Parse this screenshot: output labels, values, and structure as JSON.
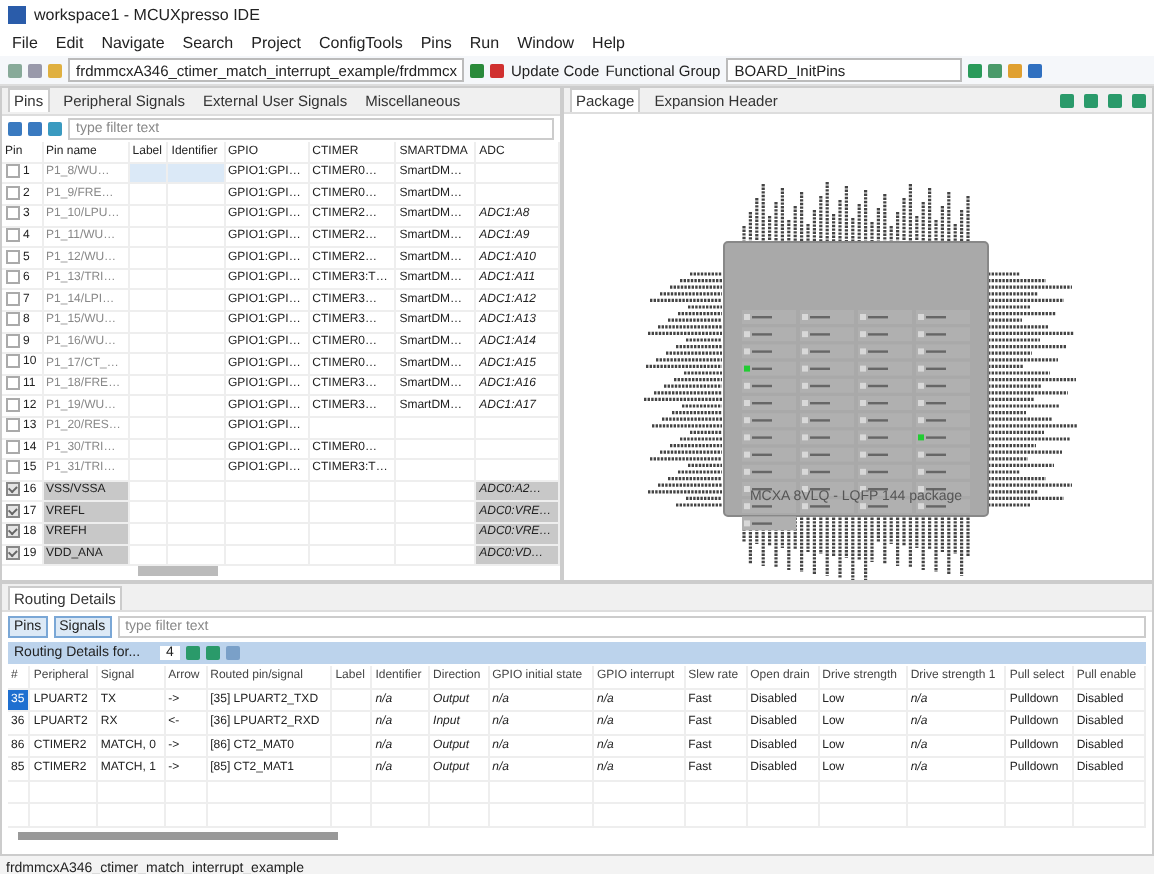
{
  "window": {
    "title": "workspace1 - MCUXpresso IDE"
  },
  "menu": [
    "File",
    "Edit",
    "Navigate",
    "Search",
    "Project",
    "ConfigTools",
    "Pins",
    "Run",
    "Window",
    "Help"
  ],
  "toolbar": {
    "project_path": "frdmmcxA346_ctimer_match_interrupt_example/frdmmcx",
    "update_code": "Update Code",
    "functional_group_label": "Functional Group",
    "functional_group": "BOARD_InitPins"
  },
  "pins_view": {
    "tabs": [
      {
        "label": "Pins",
        "selected": true
      },
      {
        "label": "Peripheral Signals",
        "selected": false
      },
      {
        "label": "External User Signals",
        "selected": false
      },
      {
        "label": "Miscellaneous",
        "selected": false
      }
    ],
    "filter": {
      "placeholder": "type filter text"
    },
    "columns": [
      "Pin",
      "Pin name",
      "Label",
      "Identifier",
      "GPIO",
      "CTIMER",
      "SMARTDMA",
      "ADC"
    ],
    "rows": [
      {
        "checked": false,
        "selected": true,
        "disabled": false,
        "cells": [
          "1",
          "P1_8/WU…",
          "",
          "",
          "GPIO1:GPI…",
          "CTIMER0…",
          "SmartDM…",
          ""
        ]
      },
      {
        "checked": false,
        "selected": false,
        "disabled": false,
        "cells": [
          "2",
          "P1_9/FRE…",
          "",
          "",
          "GPIO1:GPI…",
          "CTIMER0…",
          "SmartDM…",
          ""
        ]
      },
      {
        "checked": false,
        "selected": false,
        "disabled": false,
        "cells": [
          "3",
          "P1_10/LPU…",
          "",
          "",
          "GPIO1:GPI…",
          "CTIMER2…",
          "SmartDM…",
          "ADC1:A8"
        ]
      },
      {
        "checked": false,
        "selected": false,
        "disabled": false,
        "cells": [
          "4",
          "P1_11/WU…",
          "",
          "",
          "GPIO1:GPI…",
          "CTIMER2…",
          "SmartDM…",
          "ADC1:A9"
        ]
      },
      {
        "checked": false,
        "selected": false,
        "disabled": false,
        "cells": [
          "5",
          "P1_12/WU…",
          "",
          "",
          "GPIO1:GPI…",
          "CTIMER2…",
          "SmartDM…",
          "ADC1:A10"
        ]
      },
      {
        "checked": false,
        "selected": false,
        "disabled": false,
        "cells": [
          "6",
          "P1_13/TRI…",
          "",
          "",
          "GPIO1:GPI…",
          "CTIMER3:T…",
          "SmartDM…",
          "ADC1:A11"
        ]
      },
      {
        "checked": false,
        "selected": false,
        "disabled": false,
        "cells": [
          "7",
          "P1_14/LPI…",
          "",
          "",
          "GPIO1:GPI…",
          "CTIMER3…",
          "SmartDM…",
          "ADC1:A12"
        ]
      },
      {
        "checked": false,
        "selected": false,
        "disabled": false,
        "cells": [
          "8",
          "P1_15/WU…",
          "",
          "",
          "GPIO1:GPI…",
          "CTIMER3…",
          "SmartDM…",
          "ADC1:A13"
        ]
      },
      {
        "checked": false,
        "selected": false,
        "disabled": false,
        "cells": [
          "9",
          "P1_16/WU…",
          "",
          "",
          "GPIO1:GPI…",
          "CTIMER0…",
          "SmartDM…",
          "ADC1:A14"
        ]
      },
      {
        "checked": false,
        "selected": false,
        "disabled": false,
        "cells": [
          "10",
          "P1_17/CT_…",
          "",
          "",
          "GPIO1:GPI…",
          "CTIMER0…",
          "SmartDM…",
          "ADC1:A15"
        ]
      },
      {
        "checked": false,
        "selected": false,
        "disabled": false,
        "cells": [
          "11",
          "P1_18/FRE…",
          "",
          "",
          "GPIO1:GPI…",
          "CTIMER3…",
          "SmartDM…",
          "ADC1:A16"
        ]
      },
      {
        "checked": false,
        "selected": false,
        "disabled": false,
        "cells": [
          "12",
          "P1_19/WU…",
          "",
          "",
          "GPIO1:GPI…",
          "CTIMER3…",
          "SmartDM…",
          "ADC1:A17"
        ]
      },
      {
        "checked": false,
        "selected": false,
        "disabled": false,
        "cells": [
          "13",
          "P1_20/RES…",
          "",
          "",
          "GPIO1:GPI…",
          "",
          "",
          ""
        ]
      },
      {
        "checked": false,
        "selected": false,
        "disabled": false,
        "cells": [
          "14",
          "P1_30/TRI…",
          "",
          "",
          "GPIO1:GPI…",
          "CTIMER0…",
          "",
          ""
        ]
      },
      {
        "checked": false,
        "selected": false,
        "disabled": false,
        "cells": [
          "15",
          "P1_31/TRI…",
          "",
          "",
          "GPIO1:GPI…",
          "CTIMER3:T…",
          "",
          ""
        ]
      },
      {
        "checked": true,
        "selected": false,
        "disabled": true,
        "cells": [
          "16",
          "VSS/VSSA",
          "",
          "",
          "",
          "",
          "",
          "ADC0:A2…"
        ]
      },
      {
        "checked": true,
        "selected": false,
        "disabled": true,
        "cells": [
          "17",
          "VREFL",
          "",
          "",
          "",
          "",
          "",
          "ADC0:VRE…"
        ]
      },
      {
        "checked": true,
        "selected": false,
        "disabled": true,
        "cells": [
          "18",
          "VREFH",
          "",
          "",
          "",
          "",
          "",
          "ADC0:VRE…"
        ]
      },
      {
        "checked": true,
        "selected": false,
        "disabled": true,
        "cells": [
          "19",
          "VDD_ANA",
          "",
          "",
          "",
          "",
          "",
          "ADC0:VD…"
        ]
      }
    ]
  },
  "package_view": {
    "tabs": [
      {
        "label": "Package",
        "selected": true
      },
      {
        "label": "Expansion Header",
        "selected": false
      }
    ],
    "chip_title": "MCXA 8VLQ - LQFP 144 package"
  },
  "routing": {
    "tab": "Routing Details",
    "toggles": [
      {
        "label": "Pins",
        "selected": true
      },
      {
        "label": "Signals",
        "selected": true
      }
    ],
    "filter": {
      "placeholder": "type filter text"
    },
    "header_label": "Routing Details for...",
    "count": "4",
    "columns": [
      "#",
      "Peripheral",
      "Signal",
      "Arrow",
      "Routed pin/signal",
      "Label",
      "Identifier",
      "Direction",
      "GPIO initial state",
      "GPIO interrupt",
      "Slew rate",
      "Open drain",
      "Drive strength",
      "Drive strength 1",
      "Pull select",
      "Pull enable"
    ],
    "rows": [
      {
        "selected": true,
        "cells": [
          "35",
          "LPUART2",
          "TX",
          "->",
          "[35] LPUART2_TXD",
          "",
          "n/a",
          "Output",
          "n/a",
          "n/a",
          "Fast",
          "Disabled",
          "Low",
          "n/a",
          "Pulldown",
          "Disabled"
        ]
      },
      {
        "selected": false,
        "cells": [
          "36",
          "LPUART2",
          "RX",
          "<-",
          "[36] LPUART2_RXD",
          "",
          "n/a",
          "Input",
          "n/a",
          "n/a",
          "Fast",
          "Disabled",
          "Low",
          "n/a",
          "Pulldown",
          "Disabled"
        ]
      },
      {
        "selected": false,
        "cells": [
          "86",
          "CTIMER2",
          "MATCH, 0",
          "->",
          "[86] CT2_MAT0",
          "",
          "n/a",
          "Output",
          "n/a",
          "n/a",
          "Fast",
          "Disabled",
          "Low",
          "n/a",
          "Pulldown",
          "Disabled"
        ]
      },
      {
        "selected": false,
        "cells": [
          "85",
          "CTIMER2",
          "MATCH, 1",
          "->",
          "[85] CT2_MAT1",
          "",
          "n/a",
          "Output",
          "n/a",
          "n/a",
          "Fast",
          "Disabled",
          "Low",
          "n/a",
          "Pulldown",
          "Disabled"
        ]
      }
    ]
  },
  "status_bar": {
    "text": "frdmmcxA346_ctimer_match_interrupt_example"
  }
}
